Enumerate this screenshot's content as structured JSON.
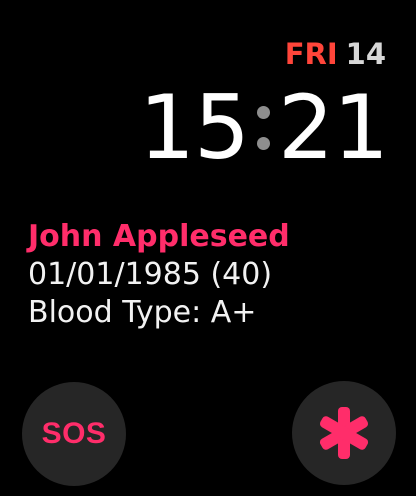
{
  "status": {
    "day": "FRI",
    "date": "14"
  },
  "clock": {
    "hours": "15",
    "minutes": "21"
  },
  "medical_id": {
    "name": "John Appleseed",
    "dob": "01/01/1985 (40)",
    "blood_type": "Blood Type: A+"
  },
  "actions": {
    "sos_label": "SOS",
    "medical_icon": "asterisk-icon"
  },
  "colors": {
    "day_accent": "#ff453a",
    "medical_accent": "#ff2d6a",
    "button_bg": "#262626"
  }
}
